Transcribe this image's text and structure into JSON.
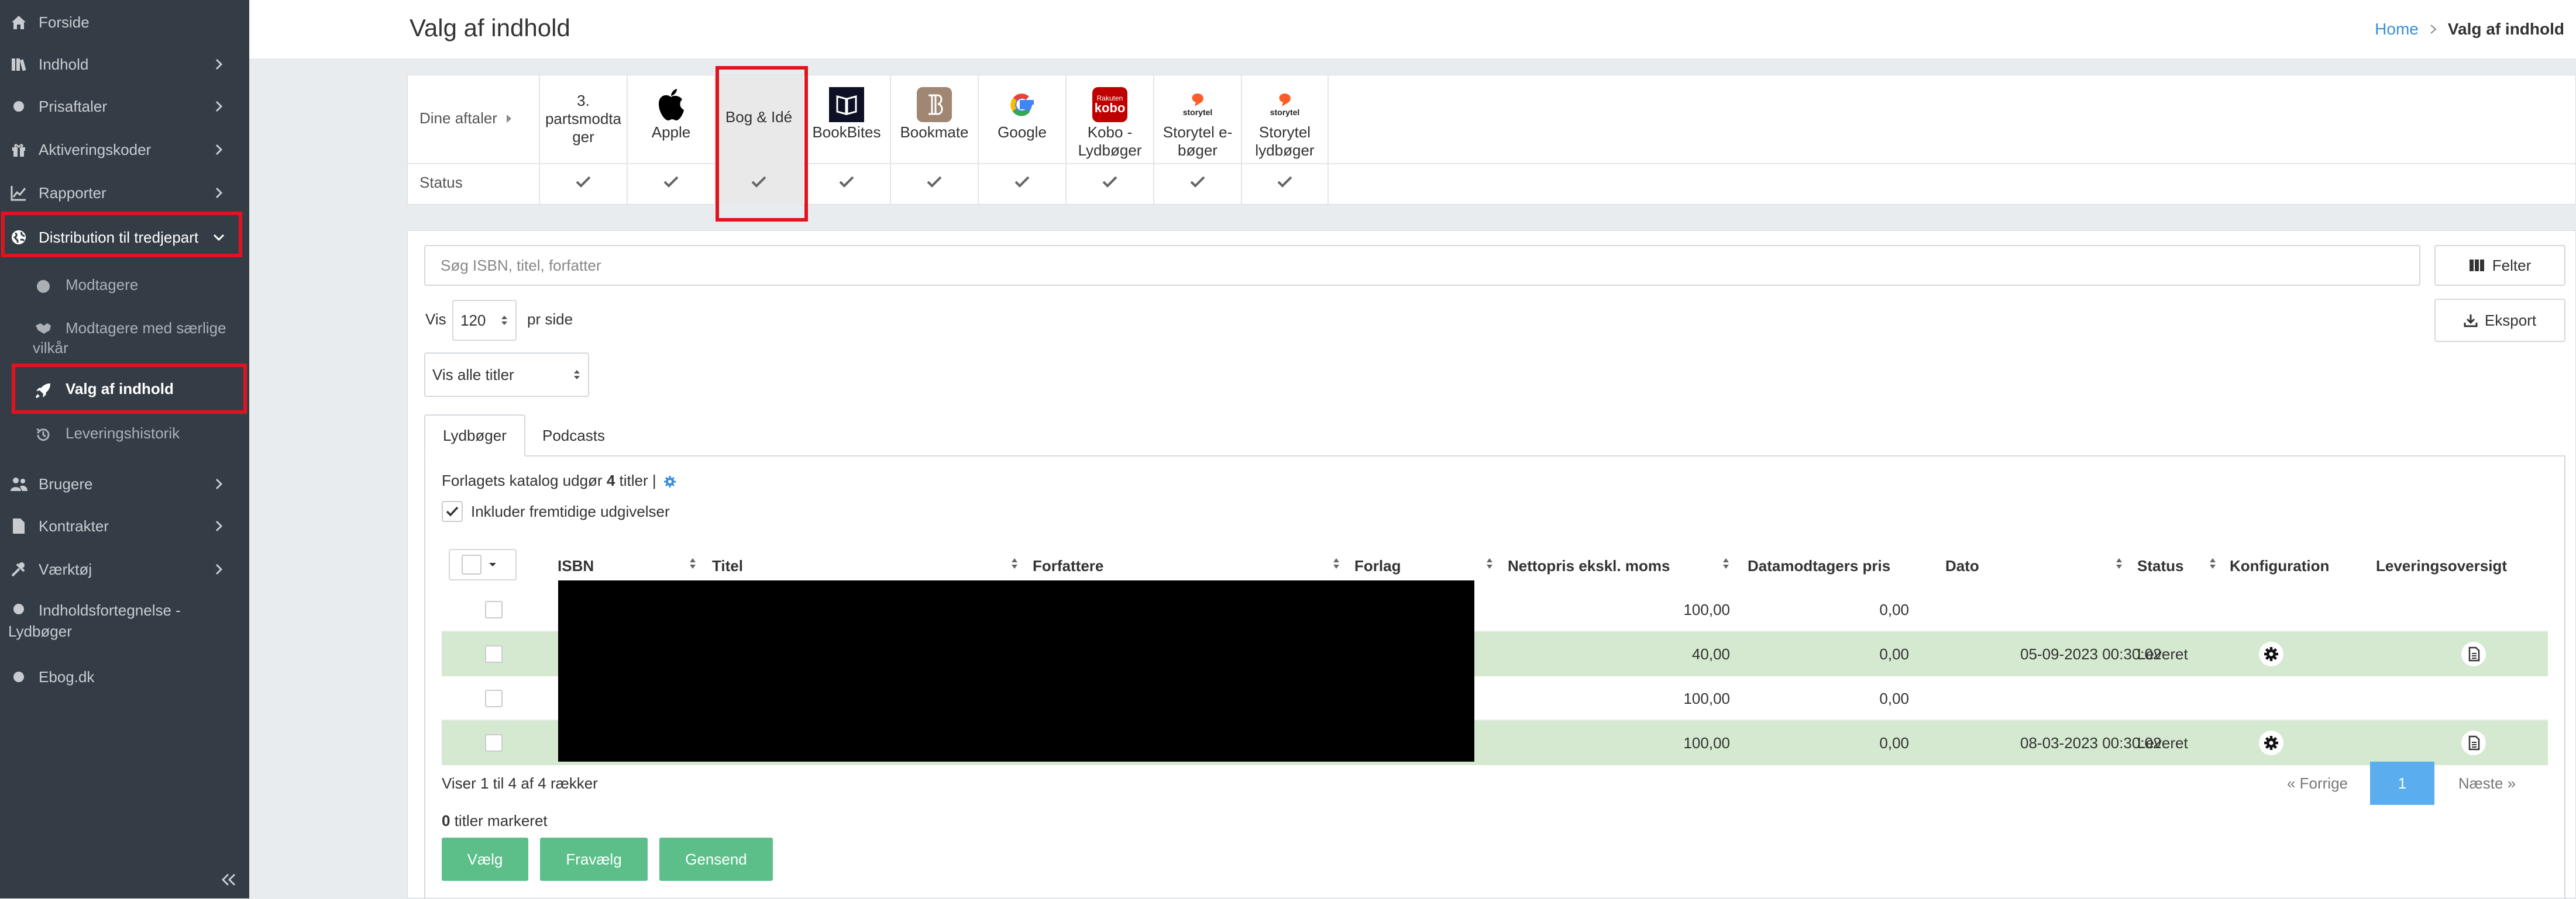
{
  "sidebar": {
    "items": [
      {
        "label": "Forside"
      },
      {
        "label": "Indhold"
      },
      {
        "label": "Prisaftaler"
      },
      {
        "label": "Aktiveringskoder"
      },
      {
        "label": "Rapporter"
      },
      {
        "label": "Distribution til tredjepart"
      },
      {
        "label": "Brugere"
      },
      {
        "label": "Kontrakter"
      },
      {
        "label": "Værktøj"
      },
      {
        "label": "Indholdsfortegnelse -",
        "label2": "Lydbøger"
      },
      {
        "label": "Ebog.dk"
      }
    ],
    "subitems": [
      {
        "label": "Modtagere"
      },
      {
        "label": "Modtagere med særlige",
        "label2": "vilkår"
      },
      {
        "label": "Valg af indhold"
      },
      {
        "label": "Leveringshistorik"
      }
    ]
  },
  "header": {
    "title": "Valg af indhold",
    "breadcrumb_home": "Home",
    "breadcrumb_current": "Valg af indhold"
  },
  "partners": {
    "row_label": "Dine aftaler",
    "status_label": "Status",
    "columns": [
      {
        "l1": "3.",
        "l2": "partsmodta",
        "l3": "ger"
      },
      {
        "l1": "Apple"
      },
      {
        "l1": "Bog & Idé"
      },
      {
        "l1": "BookBites"
      },
      {
        "l1": "Bookmate"
      },
      {
        "l1": "Google"
      },
      {
        "l1": "Kobo -",
        "l2": "Lydbøger"
      },
      {
        "l1": "Storytel e-",
        "l2": "bøger"
      },
      {
        "l1": "Storytel",
        "l2": "lydbøger"
      }
    ],
    "logo_texts": {
      "kobo_small": "Rakuten",
      "kobo": "kobo",
      "storytel": "storytel"
    }
  },
  "search": {
    "placeholder": "Søg ISBN, titel, forfatter"
  },
  "buttons": {
    "felter": "Felter",
    "eksport": "Eksport"
  },
  "paging": {
    "vis": "Vis",
    "per_page": "120",
    "pr_side": "pr side"
  },
  "filter": {
    "value": "Vis alle titler"
  },
  "tabs": [
    {
      "label": "Lydbøger"
    },
    {
      "label": "Podcasts"
    }
  ],
  "catalog": {
    "prefix": "Forlagets katalog udgør",
    "count": "4",
    "suffix": "titler |"
  },
  "include_future": "Inkluder fremtidige udgivelser",
  "table": {
    "headers": [
      "ISBN",
      "Titel",
      "Forfattere",
      "Forlag",
      "Nettopris ekskl. moms",
      "Datamodtagers pris",
      "Dato",
      "Status",
      "Konfiguration",
      "Leveringsoversigt"
    ],
    "rows": [
      {
        "netto": "100,00",
        "pris": "0,00",
        "dato": "",
        "status": ""
      },
      {
        "netto": "40,00",
        "pris": "0,00",
        "dato": "05-09-2023 00:30:02",
        "status": "Leveret"
      },
      {
        "netto": "100,00",
        "pris": "0,00",
        "dato": "",
        "status": ""
      },
      {
        "netto": "100,00",
        "pris": "0,00",
        "dato": "08-03-2023 00:30:02",
        "status": "Leveret"
      }
    ]
  },
  "footer": {
    "showing": "Viser 1 til 4 af 4 rækker",
    "marked_count": "0",
    "marked_suffix": "titler markeret",
    "prev": "« Forrige",
    "page": "1",
    "next": "Næste »"
  },
  "actions": {
    "choose": "Vælg",
    "unchoose": "Fravælg",
    "resend": "Gensend"
  },
  "colors": {
    "sidebar": "#343d46",
    "highlight": "#e0141e",
    "green_row": "#d4e9cf",
    "action_green": "#5cbf8a",
    "link_blue": "#3a8fd9",
    "pager_active": "#5aaef0"
  }
}
